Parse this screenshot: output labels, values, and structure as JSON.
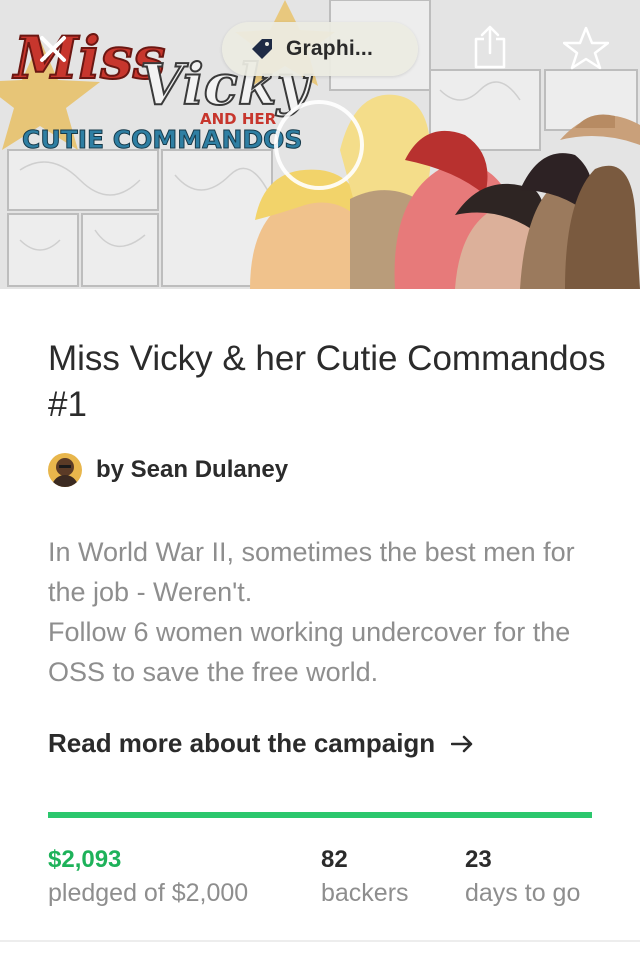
{
  "hero": {
    "category_label": "Graphi...",
    "category_icon": "tag-icon",
    "close_icon": "close-icon",
    "share_icon": "share-icon",
    "star_icon": "star-icon",
    "play_icon": "play-button-icon",
    "logo_line1": "Miss",
    "logo_line2": "Vicky",
    "logo_line3": "AND HER",
    "logo_line4": "CUTIE COMMANDOS"
  },
  "project": {
    "title": "Miss Vicky & her Cutie Commandos #1",
    "creator": "by Sean Dulaney",
    "blurb_line1": "In World War II, sometimes the best men for the job - Weren't.",
    "blurb_line2": "Follow 6 women working undercover for the OSS to save the free world.",
    "read_more": "Read more about the campaign"
  },
  "funding": {
    "progress_fraction": 1.0,
    "pledged_value": "$2,093",
    "pledged_label": "pledged of $2,000",
    "backers_value": "82",
    "backers_label": "backers",
    "days_value": "23",
    "days_label": "days to go"
  },
  "colors": {
    "accent_green": "#2bc76d",
    "pledged_green": "#1eb25a",
    "muted_text": "#8e8e8e"
  }
}
